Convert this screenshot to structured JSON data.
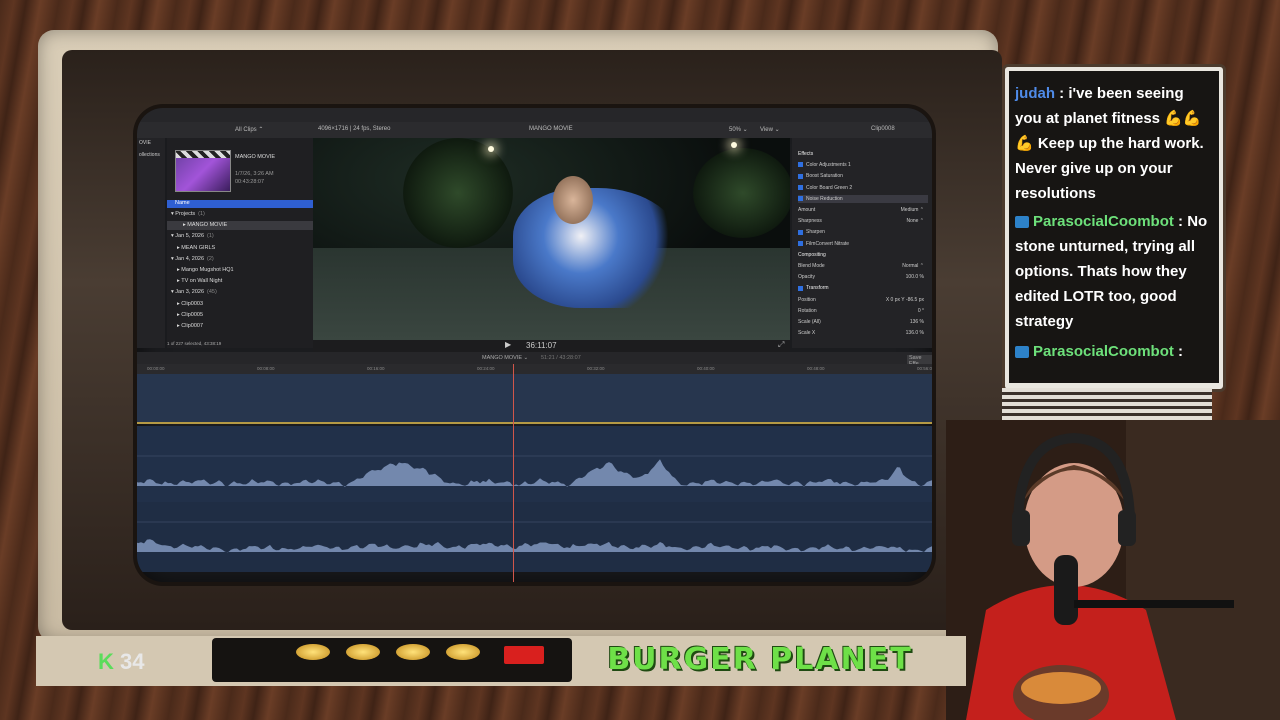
{
  "fcp": {
    "library_filter": "All Clips ⌃",
    "format_info": "4096×1716 | 24 fps, Stereo",
    "viewer_title": "MANGO MOVIE",
    "zoom": "50% ⌄",
    "view_menu": "View ⌄",
    "inspector_clip": "Clip0008",
    "side_items": [
      "OVIE",
      "ollections"
    ],
    "thumb_title": "MANGO MOVIE",
    "thumb_date": "1/7/26, 3:26 AM",
    "thumb_duration": "00:43:28:07",
    "name_header": "Name",
    "tree": [
      {
        "label": "Projects",
        "count": "(1)",
        "indent": 0
      },
      {
        "label": "MANGO MOVIE",
        "count": "",
        "indent": 2,
        "selected": true
      },
      {
        "label": "Jan 5, 2026",
        "count": "(1)",
        "indent": 0
      },
      {
        "label": "MEAN GIRLS",
        "count": "",
        "indent": 1
      },
      {
        "label": "Jan 4, 2026",
        "count": "(2)",
        "indent": 0
      },
      {
        "label": "Mango Mugshot HQ1",
        "count": "",
        "indent": 1
      },
      {
        "label": "TV on Wall Night",
        "count": "",
        "indent": 1
      },
      {
        "label": "Jan 3, 2026",
        "count": "(45)",
        "indent": 0
      },
      {
        "label": "Clip0003",
        "count": "",
        "indent": 1
      },
      {
        "label": "Clip0005",
        "count": "",
        "indent": 1
      },
      {
        "label": "Clip0007",
        "count": "",
        "indent": 1
      }
    ],
    "selection_status": "1 of 227 selected, 43:38:19",
    "timecode": "36:11:07",
    "timeline_title": "MANGO MOVIE ⌄",
    "timeline_duration": "51:21 / 43:28:07",
    "save_effects": "Save Effe",
    "ruler_ticks": [
      "00:00:00",
      "00:08:00",
      "00:16:00",
      "00:24:00",
      "00:32:00",
      "00:40:00",
      "00:48:00",
      "00:56:00"
    ],
    "inspector": [
      {
        "label": "Effects",
        "value": "",
        "checked": false,
        "header": true
      },
      {
        "label": "Color Adjustments 1",
        "value": "",
        "checked": true
      },
      {
        "label": "Boost Saturation",
        "value": "",
        "checked": true
      },
      {
        "label": "Color Board Green 2",
        "value": "",
        "checked": true
      },
      {
        "label": "Noise Reduction",
        "value": "",
        "checked": true,
        "highlight": true
      },
      {
        "label": "Amount",
        "value": "Medium ⌃",
        "checked": false
      },
      {
        "label": "Sharpness",
        "value": "None ⌃",
        "checked": false
      },
      {
        "label": "Sharpen",
        "value": "",
        "checked": true
      },
      {
        "label": "FilmConvert Nitrate",
        "value": "",
        "checked": true
      },
      {
        "label": "Compositing",
        "value": "",
        "checked": false,
        "header": true
      },
      {
        "label": "Blend Mode",
        "value": "Normal ⌃",
        "checked": false
      },
      {
        "label": "Opacity",
        "value": "100.0 %",
        "checked": false
      },
      {
        "label": "Transform",
        "value": "",
        "checked": true,
        "header": true
      },
      {
        "label": "Position",
        "value": "X 0 px  Y -86.5 px",
        "checked": false
      },
      {
        "label": "Rotation",
        "value": "0 °",
        "checked": false
      },
      {
        "label": "Scale (All)",
        "value": "136 %",
        "checked": false
      },
      {
        "label": "Scale X",
        "value": "136.0 %",
        "checked": false
      }
    ]
  },
  "chat": {
    "messages": [
      {
        "user": "judah",
        "text": "i've been seeing you at planet fitness 💪💪💪 Keep up the hard work. Never give up on your resolutions",
        "badge": false
      },
      {
        "user": "ParasocialCoombot",
        "text": "No stone unturned, trying all options. Thats how they edited LOTR too, good strategy",
        "badge": true
      },
      {
        "user": "ParasocialCoombot",
        "text": "",
        "badge": true
      }
    ]
  },
  "overlay": {
    "k_label": "K",
    "k_count": "34",
    "sponsor": "BURGER PLANET",
    "knob_labels": [
      "",
      "",
      "",
      ""
    ]
  },
  "colors": {
    "accent_blue": "#2f5fd1",
    "playhead": "#d0564a",
    "chat_user": "#4f8be8",
    "chat_bot": "#6de07a",
    "sponsor_green": "#6ee048"
  }
}
